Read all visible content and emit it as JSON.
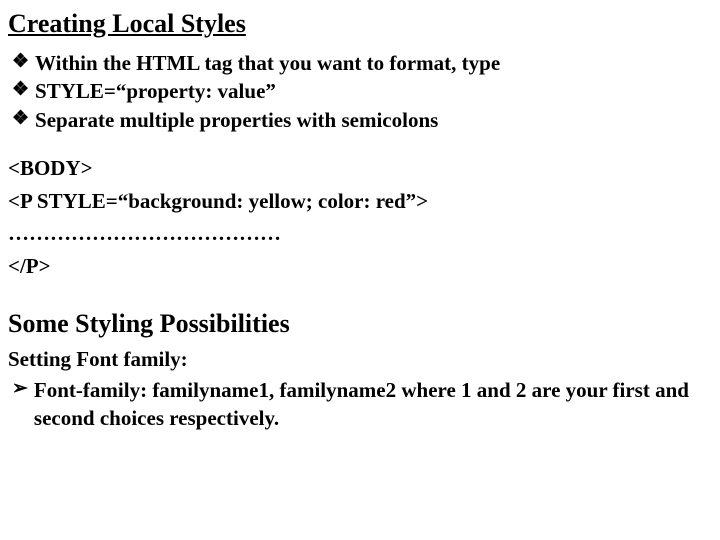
{
  "section1": {
    "heading": "Creating Local Styles",
    "bullets": [
      "Within the HTML tag that you want to format, type",
      "STYLE=“property: value”",
      "Separate multiple properties with semicolons"
    ],
    "code": [
      "<BODY>",
      "<P STYLE=“background: yellow; color: red”>",
      "…………………………………",
      "</P>"
    ]
  },
  "section2": {
    "heading": "Some Styling Possibilities",
    "subheading": "Setting Font family:",
    "arrows": [
      "Font-family: familyname1, familyname2  where 1 and 2 are your first and second choices respectively."
    ]
  },
  "markers": {
    "diamond": "❖",
    "arrow": "➢"
  }
}
